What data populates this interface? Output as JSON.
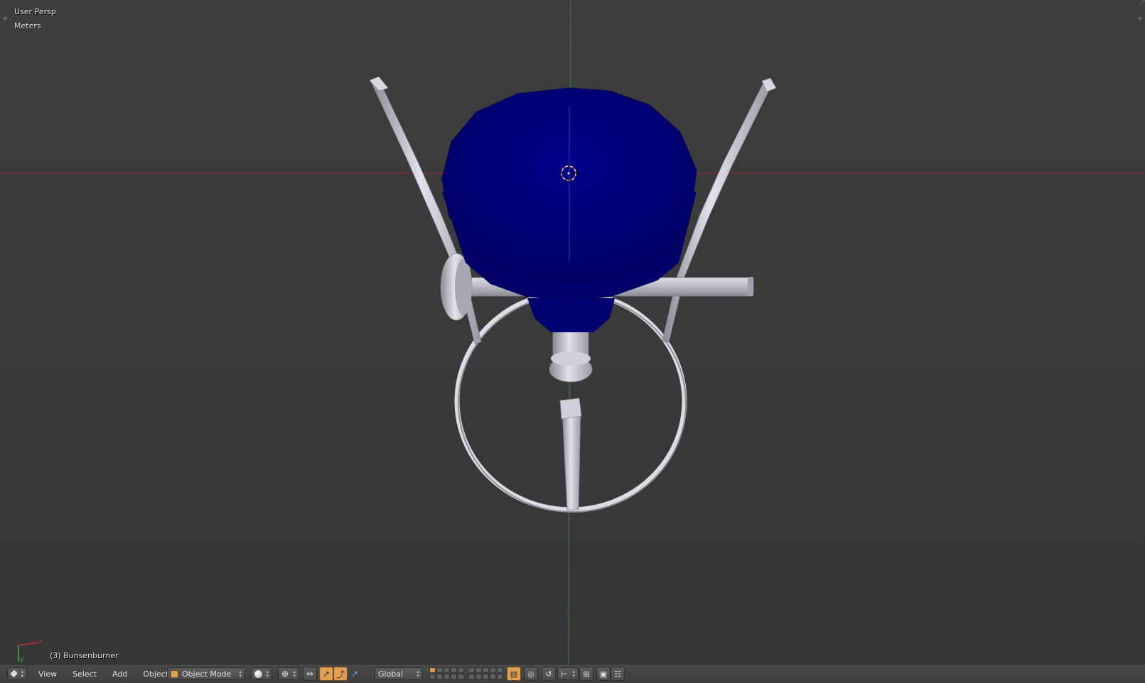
{
  "viewport": {
    "view_name": "User Persp",
    "units": "Meters",
    "active_object": "(3) Bunsenburner",
    "axis_colors": {
      "x": "#b03030",
      "y": "#3aa03a"
    },
    "object_color": "#00007a",
    "metal_color": "#c8c8d2"
  },
  "header": {
    "editor_icon": "3d-view-icon",
    "menus": [
      "View",
      "Select",
      "Add",
      "Object"
    ],
    "mode": {
      "icon": "object-mode-cube-icon",
      "label": "Object Mode"
    },
    "shading_icon": "solid-shading-sphere-icon",
    "pivot_icon": "pivot-point-icon",
    "manipulator_icon": "transform-manipulator-icon",
    "orientation": "Global",
    "layers_active": 1
  }
}
